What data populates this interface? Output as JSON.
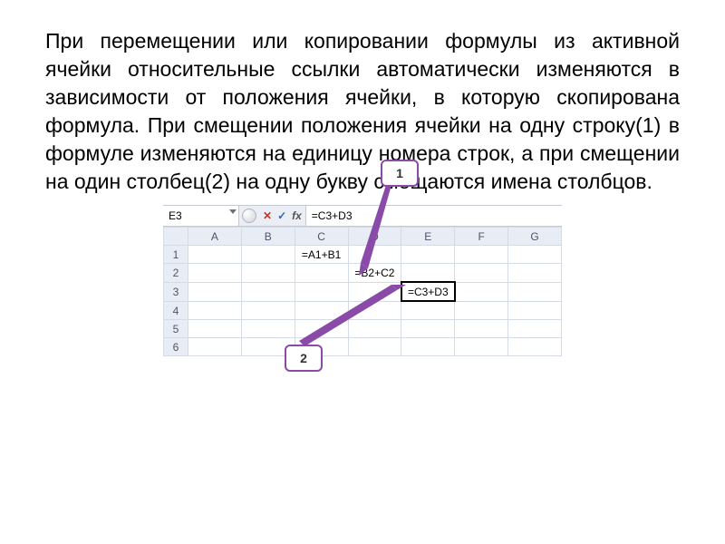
{
  "paragraph": "При перемещении или копировании формулы из активной ячейки относительные ссылки автоматически изменяются в зависимости от положения ячейки, в которую скопирована формула. При смещении положения ячейки на одну строку(1) в формуле изменяются на единицу номера строк, а при смещении на один столбец(2) на одну букву смещаются имена столбцов.",
  "callouts": {
    "one": "1",
    "two": "2"
  },
  "formulabar": {
    "name": "E3",
    "cancel": "✕",
    "accept": "✓",
    "fx": "fx",
    "formula": "=C3+D3"
  },
  "columns": [
    "A",
    "B",
    "C",
    "D",
    "E",
    "F",
    "G"
  ],
  "rows": [
    {
      "num": "1",
      "cells": [
        "",
        "",
        "=A1+B1",
        "",
        "",
        "",
        ""
      ]
    },
    {
      "num": "2",
      "cells": [
        "",
        "",
        "",
        "=B2+C2",
        "",
        "",
        ""
      ]
    },
    {
      "num": "3",
      "cells": [
        "",
        "",
        "",
        "",
        "=C3+D3",
        "",
        ""
      ]
    },
    {
      "num": "4",
      "cells": [
        "",
        "",
        "",
        "",
        "",
        "",
        ""
      ]
    },
    {
      "num": "5",
      "cells": [
        "",
        "",
        "",
        "",
        "",
        "",
        ""
      ]
    },
    {
      "num": "6",
      "cells": [
        "",
        "",
        "",
        "",
        "",
        "",
        ""
      ]
    }
  ],
  "active": {
    "row": 2,
    "col": 4
  }
}
